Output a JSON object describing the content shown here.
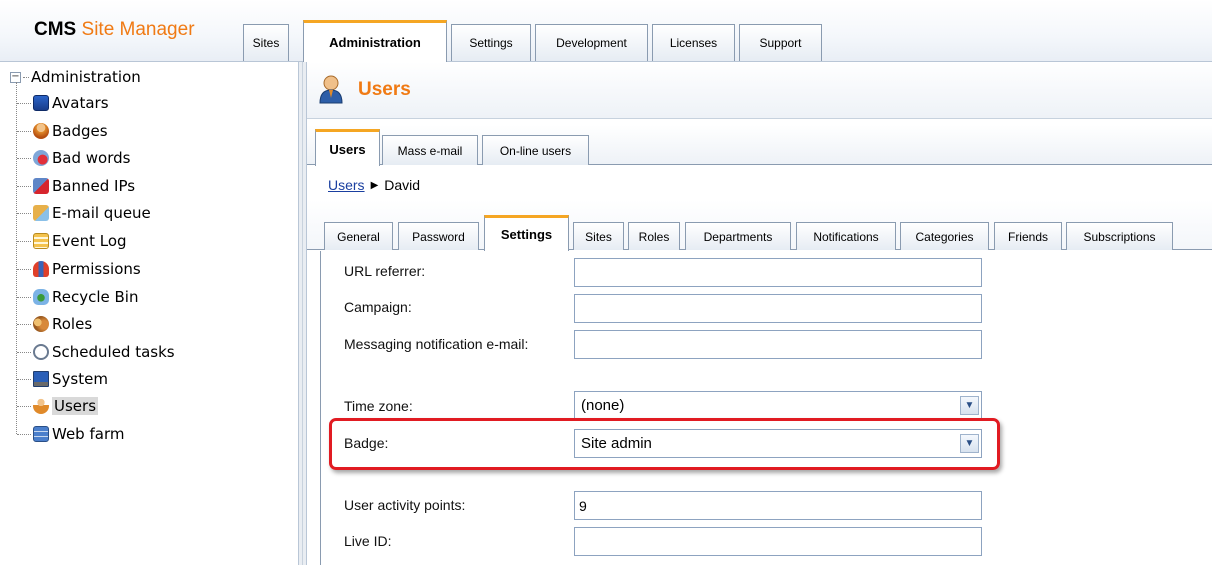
{
  "header": {
    "logo_cms": "CMS",
    "logo_site_manager": "Site Manager",
    "tabs": [
      {
        "label": "Sites"
      },
      {
        "label": "Administration"
      },
      {
        "label": "Settings"
      },
      {
        "label": "Development"
      },
      {
        "label": "Licenses"
      },
      {
        "label": "Support"
      }
    ],
    "active_tab": "Administration"
  },
  "tree": {
    "root": "Administration",
    "items": [
      {
        "label": "Avatars",
        "icon": "avatars-icon"
      },
      {
        "label": "Badges",
        "icon": "badges-icon"
      },
      {
        "label": "Bad words",
        "icon": "bad-words-icon"
      },
      {
        "label": "Banned IPs",
        "icon": "banned-ips-icon"
      },
      {
        "label": "E-mail queue",
        "icon": "email-queue-icon"
      },
      {
        "label": "Event Log",
        "icon": "event-log-icon"
      },
      {
        "label": "Permissions",
        "icon": "permissions-icon"
      },
      {
        "label": "Recycle Bin",
        "icon": "recycle-bin-icon"
      },
      {
        "label": "Roles",
        "icon": "roles-icon"
      },
      {
        "label": "Scheduled tasks",
        "icon": "scheduled-tasks-icon"
      },
      {
        "label": "System",
        "icon": "system-icon"
      },
      {
        "label": "Users",
        "icon": "users-icon"
      },
      {
        "label": "Web farm",
        "icon": "web-farm-icon"
      }
    ],
    "selected": "Users"
  },
  "page": {
    "title": "Users",
    "subtabs": [
      {
        "label": "Users"
      },
      {
        "label": "Mass e-mail"
      },
      {
        "label": "On-line users"
      }
    ],
    "breadcrumb": {
      "link": "Users",
      "current": "David"
    },
    "settings_tabs": [
      {
        "label": "General"
      },
      {
        "label": "Password"
      },
      {
        "label": "Settings"
      },
      {
        "label": "Sites"
      },
      {
        "label": "Roles"
      },
      {
        "label": "Departments"
      },
      {
        "label": "Notifications"
      },
      {
        "label": "Categories"
      },
      {
        "label": "Friends"
      },
      {
        "label": "Subscriptions"
      }
    ],
    "active_settings_tab": "Settings"
  },
  "form": {
    "url_referrer": {
      "label": "URL referrer:",
      "value": ""
    },
    "campaign": {
      "label": "Campaign:",
      "value": ""
    },
    "messaging_email": {
      "label": "Messaging notification e-mail:",
      "value": ""
    },
    "time_zone": {
      "label": "Time zone:",
      "value": "(none)"
    },
    "badge": {
      "label": "Badge:",
      "value": "Site admin"
    },
    "activity_points": {
      "label": "User activity points:",
      "value": "9"
    },
    "live_id": {
      "label": "Live ID:",
      "value": ""
    }
  },
  "colors": {
    "accent_orange": "#f07a14",
    "tab_active_border": "#f5a623",
    "highlight_red": "#e11b22",
    "link_blue": "#1a3fa0"
  }
}
